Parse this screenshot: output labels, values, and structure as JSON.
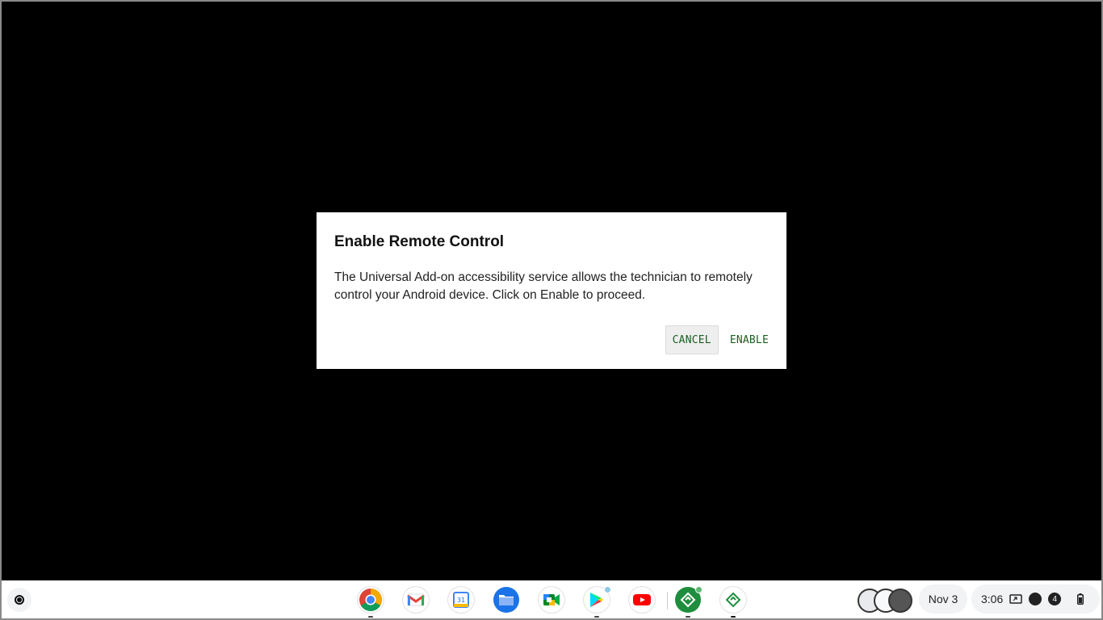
{
  "dialog": {
    "title": "Enable Remote Control",
    "body": "The Universal Add-on accessibility service allows the technician to remotely control your Android device. Click on Enable to proceed.",
    "cancel_label": "CANCEL",
    "enable_label": "ENABLE"
  },
  "shelf": {
    "apps": [
      {
        "name": "Chrome",
        "icon": "chrome-icon"
      },
      {
        "name": "Gmail",
        "icon": "gmail-icon"
      },
      {
        "name": "Calendar",
        "icon": "calendar-icon",
        "label": "31"
      },
      {
        "name": "Files",
        "icon": "files-icon"
      },
      {
        "name": "Meet",
        "icon": "meet-icon"
      },
      {
        "name": "Play Store",
        "icon": "play-store-icon"
      },
      {
        "name": "YouTube",
        "icon": "youtube-icon"
      },
      {
        "name": "Remote support app",
        "icon": "remote-support-icon"
      },
      {
        "name": "Remote support app 2",
        "icon": "remote-support-outline-icon"
      }
    ],
    "date": "Nov 3",
    "time": "3:06",
    "notification_count": "4"
  },
  "colors": {
    "screen_bg": "#000000",
    "dialog_button_text": "#1b5e20",
    "shelf_bg": "#ffffff"
  }
}
